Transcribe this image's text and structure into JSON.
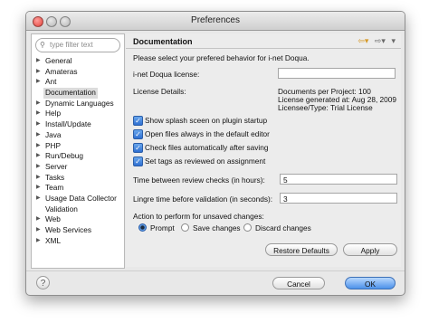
{
  "window": {
    "title": "Preferences"
  },
  "filter": {
    "placeholder": "type filter text"
  },
  "tree": [
    {
      "label": "General",
      "expandable": true
    },
    {
      "label": "Amateras",
      "expandable": true
    },
    {
      "label": "Ant",
      "expandable": true
    },
    {
      "label": "Documentation",
      "expandable": false,
      "selected": true
    },
    {
      "label": "Dynamic Languages",
      "expandable": true
    },
    {
      "label": "Help",
      "expandable": true
    },
    {
      "label": "Install/Update",
      "expandable": true
    },
    {
      "label": "Java",
      "expandable": true
    },
    {
      "label": "PHP",
      "expandable": true
    },
    {
      "label": "Run/Debug",
      "expandable": true
    },
    {
      "label": "Server",
      "expandable": true
    },
    {
      "label": "Tasks",
      "expandable": true
    },
    {
      "label": "Team",
      "expandable": true
    },
    {
      "label": "Usage Data Collector",
      "expandable": true
    },
    {
      "label": "Validation",
      "expandable": false
    },
    {
      "label": "Web",
      "expandable": true
    },
    {
      "label": "Web Services",
      "expandable": true
    },
    {
      "label": "XML",
      "expandable": true
    }
  ],
  "page": {
    "title": "Documentation",
    "intro": "Please select your prefered    behavior for i-net Doqua.",
    "license_label": "i-net Doqua license:",
    "license_value": "",
    "details_label": "License Details:",
    "details": [
      "Documents per Project: 100",
      "License generated at: Aug 28, 2009",
      "Licensee/Type: Trial License"
    ],
    "checkboxes": [
      {
        "label": "Show splash sceen on plugin startup",
        "checked": true
      },
      {
        "label": "Open files always in the default editor",
        "checked": true
      },
      {
        "label": "Check files automatically after saving",
        "checked": true
      },
      {
        "label": "Set tags as reviewed on assignment",
        "checked": true
      }
    ],
    "review_label": "Time between review checks (in hours):",
    "review_value": "5",
    "lingre_label": "Lingre time before validation (in seconds):",
    "lingre_value": "3",
    "unsaved_label": "Action to perform for unsaved changes:",
    "radios": [
      {
        "label": "Prompt",
        "selected": true
      },
      {
        "label": "Save changes",
        "selected": false
      },
      {
        "label": "Discard changes",
        "selected": false
      }
    ],
    "restore_label": "Restore Defaults",
    "apply_label": "Apply"
  },
  "footer": {
    "help": "?",
    "cancel_label": "Cancel",
    "ok_label": "OK"
  },
  "colors": {
    "accent": "#4d92ea",
    "selection": "#dcdcdc"
  }
}
